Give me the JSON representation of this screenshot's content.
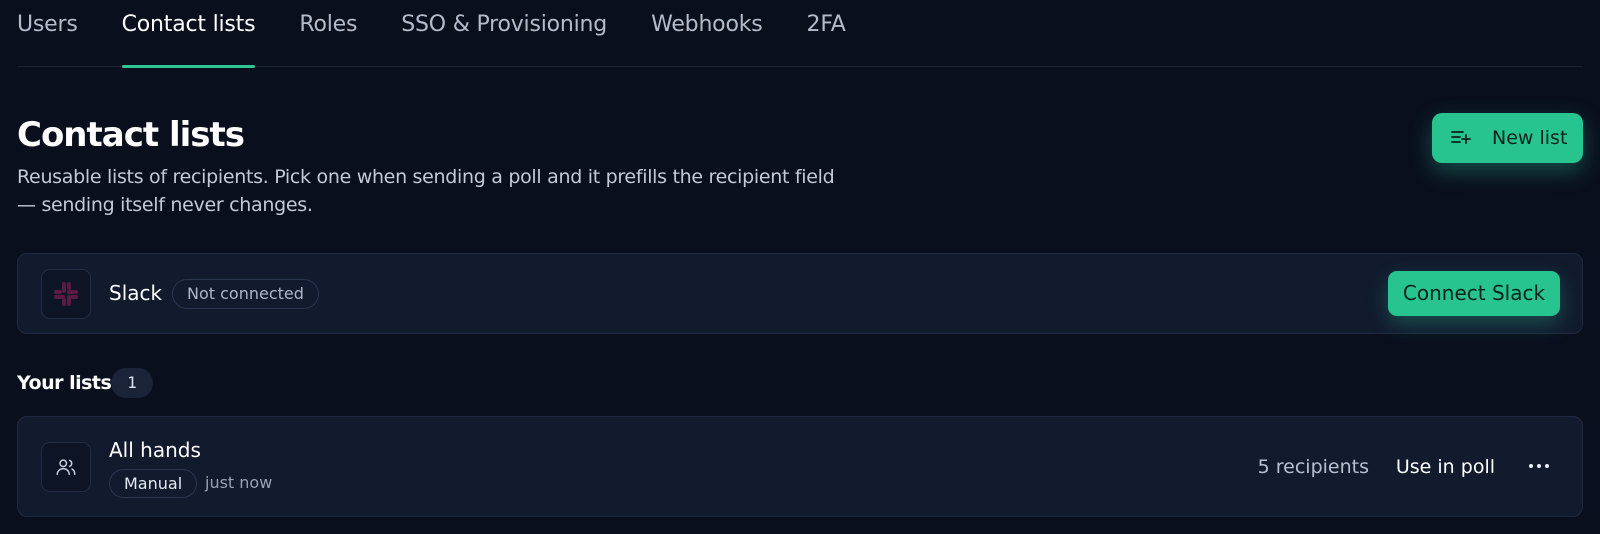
{
  "tabs": [
    {
      "label": "Users"
    },
    {
      "label": "Contact lists"
    },
    {
      "label": "Roles"
    },
    {
      "label": "SSO & Provisioning"
    },
    {
      "label": "Webhooks"
    },
    {
      "label": "2FA"
    }
  ],
  "active_tab": "Contact lists",
  "page": {
    "title": "Contact lists",
    "description": "Reusable lists of recipients. Pick one when sending a poll and it prefills the recipient field — sending itself never changes.",
    "new_list_label": "New list",
    "new_list_icon": "list-plus-icon"
  },
  "slack": {
    "name": "Slack",
    "icon": "slack-icon",
    "status": "Not connected",
    "connect_label": "Connect Slack"
  },
  "lists_section": {
    "title": "Your lists",
    "count": "1",
    "items": [
      {
        "name": "All hands",
        "icon": "users-icon",
        "source": "Manual",
        "updated": "just now",
        "recipients": "5 recipients",
        "use_label": "Use in poll",
        "more_icon": "more-horizontal-icon"
      }
    ]
  },
  "colors": {
    "background": "#0a0f1e",
    "card": "#121a2e",
    "accent": "#27c48f",
    "slack_mark": "#5a1a44"
  }
}
